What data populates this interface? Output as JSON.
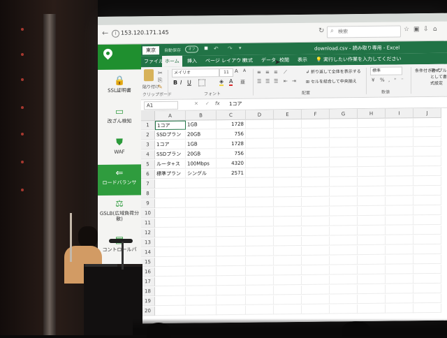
{
  "browser": {
    "url": "153.120.171.145",
    "search_placeholder": "検索",
    "back_icon": "back-arrow-icon",
    "reload_icon": "reload-icon"
  },
  "sidebar": {
    "items": [
      {
        "label": "SSL証明書",
        "icon": "lock-icon"
      },
      {
        "label": "改ざん検知",
        "icon": "monitor-icon"
      },
      {
        "label": "WAF",
        "icon": "shield-icon"
      },
      {
        "label": "ロードバランサ",
        "icon": "arrow-left-circle-icon",
        "active": true
      },
      {
        "label": "GSLB(広域負荷分散)",
        "icon": "scale-icon"
      },
      {
        "label": "コントロールパ",
        "icon": "panel-icon"
      }
    ],
    "accent": "#1f8f2f"
  },
  "excel": {
    "region": "東京",
    "autosave": "自動保存",
    "autosave_toggle": "オフ",
    "workbook_title": "download.csv - 読み取り専用 - Excel",
    "tabs": [
      "ファイル",
      "ホーム",
      "挿入",
      "ページ レイアウト",
      "数式",
      "データ",
      "校閲",
      "表示"
    ],
    "active_tab": "ホーム",
    "tell_me": "実行したい作業を入力してください",
    "ribbon": {
      "paste": "貼り付け",
      "font": "メイリオ",
      "font_size": "11",
      "wrap": "折り返して全体を表示する",
      "merge": "セルを結合して中央揃え",
      "number_format": "標準",
      "conditional": "条件付き書式",
      "table_format": "テーブルとして書式設定",
      "groups": [
        "クリップボード",
        "フォント",
        "配置",
        "数値"
      ]
    },
    "name_box": "A1",
    "formula": "1コア",
    "columns": [
      "A",
      "B",
      "C",
      "D",
      "E",
      "F",
      "G",
      "H",
      "I",
      "J"
    ],
    "rows": [
      {
        "n": "1",
        "a": "1コア",
        "b": "1GB",
        "c": "1728"
      },
      {
        "n": "2",
        "a": "SSDプラン",
        "b": "20GB",
        "c": "756"
      },
      {
        "n": "3",
        "a": "1コア",
        "b": "1GB",
        "c": "1728"
      },
      {
        "n": "4",
        "a": "SSDプラン",
        "b": "20GB",
        "c": "756"
      },
      {
        "n": "5",
        "a": "ルータ+ス",
        "b": "100Mbps",
        "c": "4320"
      },
      {
        "n": "6",
        "a": "標準プラン",
        "b": "シングル",
        "c": "2571"
      },
      {
        "n": "7"
      },
      {
        "n": "8"
      },
      {
        "n": "9"
      },
      {
        "n": "10"
      },
      {
        "n": "11"
      },
      {
        "n": "12"
      },
      {
        "n": "13"
      },
      {
        "n": "14"
      },
      {
        "n": "15"
      },
      {
        "n": "16"
      },
      {
        "n": "17"
      },
      {
        "n": "18"
      },
      {
        "n": "19"
      },
      {
        "n": "20"
      }
    ],
    "accent": "#217346"
  }
}
